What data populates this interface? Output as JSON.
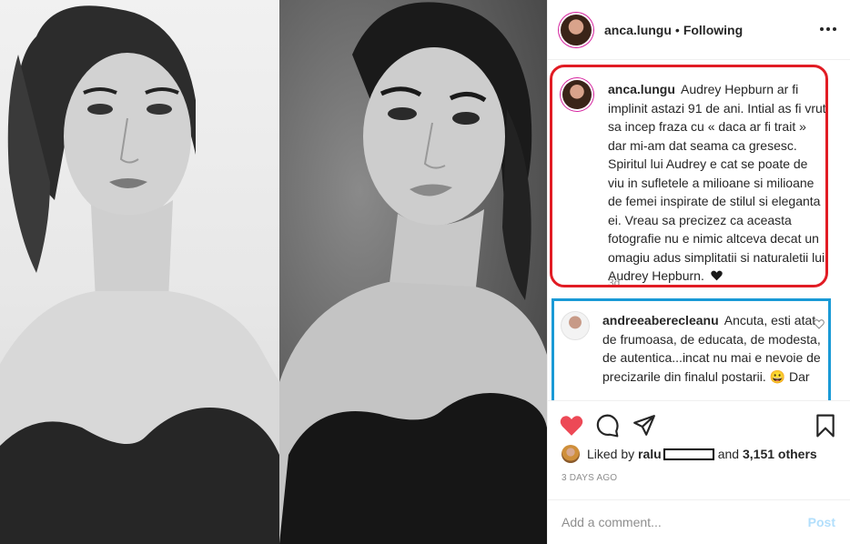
{
  "header": {
    "username": "anca.lungu",
    "separator": "•",
    "follow_status": "Following"
  },
  "caption": {
    "username": "anca.lungu",
    "text": "Audrey Hepburn ar fi implinit astazi 91 de ani. Intial as fi vrut sa incep fraza cu « daca ar fi trait » dar mi-am dat seama ca gresesc. Spiritul lui Audrey e cat se poate de viu in sufletele a milioane si milioane de femei inspirate de stilul si eleganta ei. Vreau sa precizez ca aceasta fotografie nu e nimic altceva decat un omagiu adus simplitatii si naturaletii lui Audrey Hepburn.",
    "emoji": "black-heart",
    "age": "3d"
  },
  "comment": {
    "username": "andreeaberecleanu",
    "text": "Ancuta, esti atat de frumoasa, de educata, de modesta, de autentica...incat nu mai e nevoie de precizarile din finalul postarii. 😀 Dar"
  },
  "likes": {
    "prefix": "Liked by",
    "first_user": "ralu",
    "conjunction": "and",
    "others": "3,151 others"
  },
  "date": "3 DAYS AGO",
  "add_comment": {
    "placeholder": "Add a comment...",
    "post_label": "Post"
  },
  "colors": {
    "heart_red": "#ed4956",
    "annotation_red": "#e11c24",
    "annotation_blue": "#1a9ad6",
    "post_disabled": "#b2dffc"
  },
  "icons": [
    "more-options-icon",
    "heart-icon",
    "comment-icon",
    "share-icon",
    "bookmark-icon",
    "small-heart-icon"
  ]
}
